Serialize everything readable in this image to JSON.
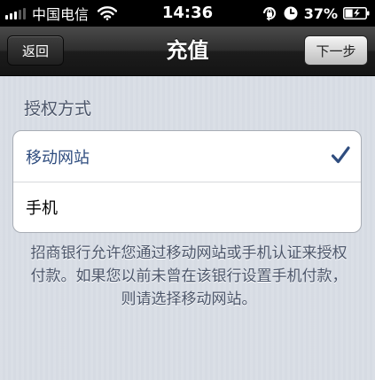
{
  "status_bar": {
    "carrier": "中国电信",
    "time": "14:36",
    "battery_percent": "37%",
    "battery_level": 0.37
  },
  "nav": {
    "back_label": "返回",
    "title": "充值",
    "next_label": "下一步"
  },
  "section": {
    "header": "授权方式",
    "options": [
      {
        "label": "移动网站",
        "selected": true
      },
      {
        "label": "手机",
        "selected": false
      }
    ],
    "footer": "招商银行允许您通过移动网站或手机认证来授权付款。如果您以前未曾在该银行设置手机付款，则请选择移动网站。"
  },
  "colors": {
    "selected_text": "#2f4d7f",
    "check": "#2f4d7f",
    "section_text": "#4c566a"
  },
  "icons": {
    "wifi": "wifi-icon",
    "rotation_lock": "rotation-lock-icon",
    "alarm": "alarm-icon",
    "battery": "battery-icon",
    "check": "checkmark-icon"
  }
}
